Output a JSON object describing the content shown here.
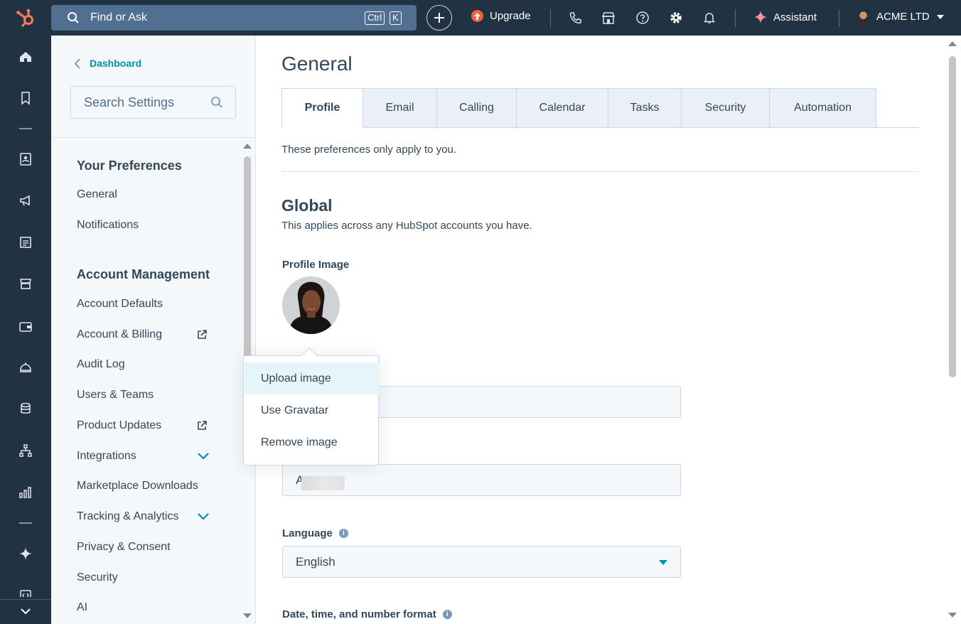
{
  "topbar": {
    "search_label": "Find or Ask",
    "kbd_ctrl": "Ctrl",
    "kbd_k": "K",
    "upgrade_label": "Upgrade",
    "assistant_label": "Assistant",
    "account_name": "ACME LTD"
  },
  "sidebar": {
    "back_label": "Dashboard",
    "search_placeholder": "Search Settings",
    "section1_title": "Your Preferences",
    "section1_items": [
      "General",
      "Notifications"
    ],
    "section2_title": "Account Management",
    "section2_items": [
      "Account Defaults",
      "Account & Billing",
      "Audit Log",
      "Users & Teams",
      "Product Updates",
      "Integrations",
      "Marketplace Downloads",
      "Tracking & Analytics",
      "Privacy & Consent",
      "Security",
      "AI"
    ]
  },
  "main": {
    "title": "General",
    "tabs": [
      "Profile",
      "Email",
      "Calling",
      "Calendar",
      "Tasks",
      "Security",
      "Automation"
    ],
    "active_tab": "Profile",
    "prefs_note": "These preferences only apply to you.",
    "section_title": "Global",
    "section_subtitle": "This applies across any HubSpot accounts you have.",
    "profile_image_label": "Profile Image",
    "second_field_value_prefix": "A",
    "language_label": "Language",
    "language_value": "English",
    "date_format_label": "Date, time, and number format"
  },
  "image_menu": {
    "items": [
      "Upload image",
      "Use Gravatar",
      "Remove image"
    ],
    "hovered": "Upload image"
  },
  "colors": {
    "nav_bg": "#213343",
    "accent": "#0091ae",
    "upgrade": "#ff5c35",
    "sidebar_bg": "#f5f8fa"
  }
}
